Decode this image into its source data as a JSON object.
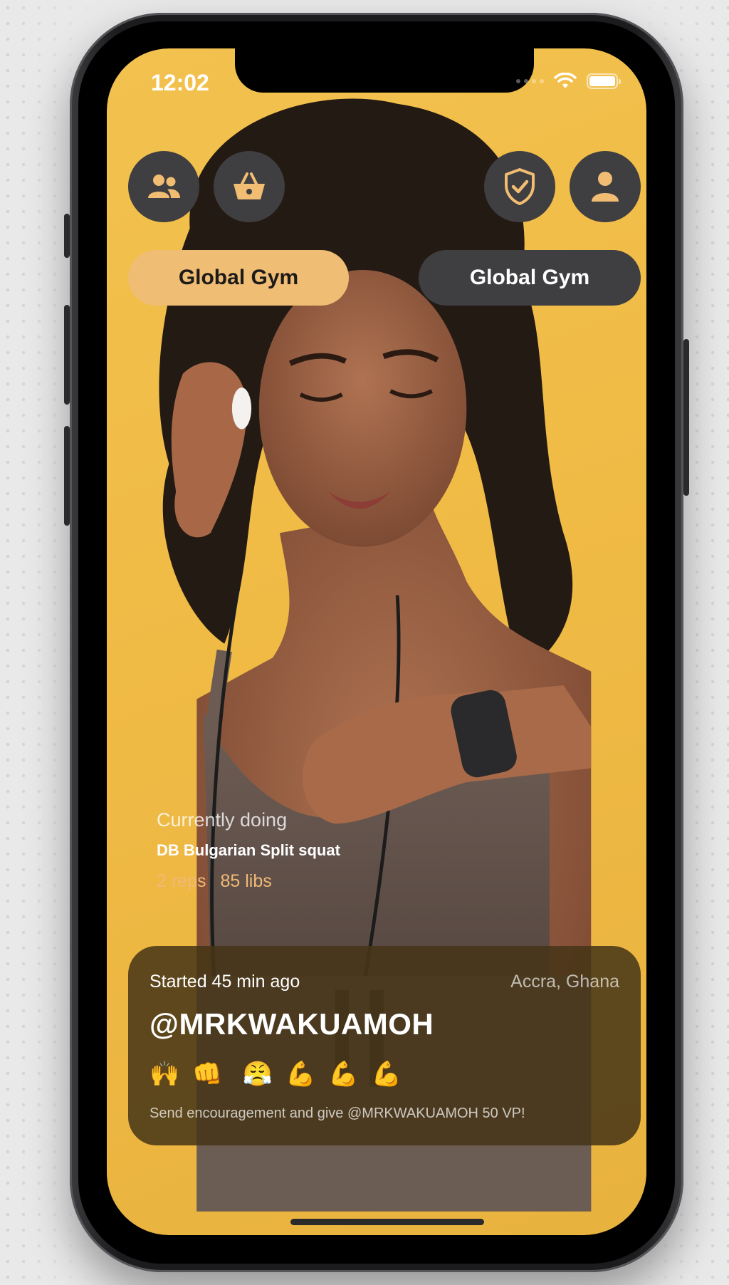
{
  "status_bar": {
    "time": "12:02"
  },
  "top_nav": {
    "left_buttons": [
      {
        "icon": "people-icon"
      },
      {
        "icon": "shopping-basket-icon"
      }
    ],
    "right_buttons": [
      {
        "icon": "shield-check-icon"
      },
      {
        "icon": "person-icon"
      }
    ]
  },
  "gym_toggle": {
    "left_label": "Global Gym",
    "right_label": "Global Gym"
  },
  "current_activity": {
    "label": "Currently doing",
    "exercise": "DB Bulgarian Split squat",
    "reps": "2 reps",
    "weight": "85 libs"
  },
  "session_card": {
    "started": "Started 45 min ago",
    "location": "Accra, Ghana",
    "username": "@MRKWAKUAMOH",
    "reactions": [
      "🙌",
      "👊",
      "😤",
      "💪",
      "💪",
      "💪"
    ],
    "note": "Send encouragement and  give @MRKWAKUAMOH 50 VP!"
  },
  "colors": {
    "screen_background": "#f2c14e",
    "button_dark": "#3f3e40",
    "accent_pill": "#efbd74",
    "card_background": "#46341",
    "stats_accent": "#f1b977"
  }
}
